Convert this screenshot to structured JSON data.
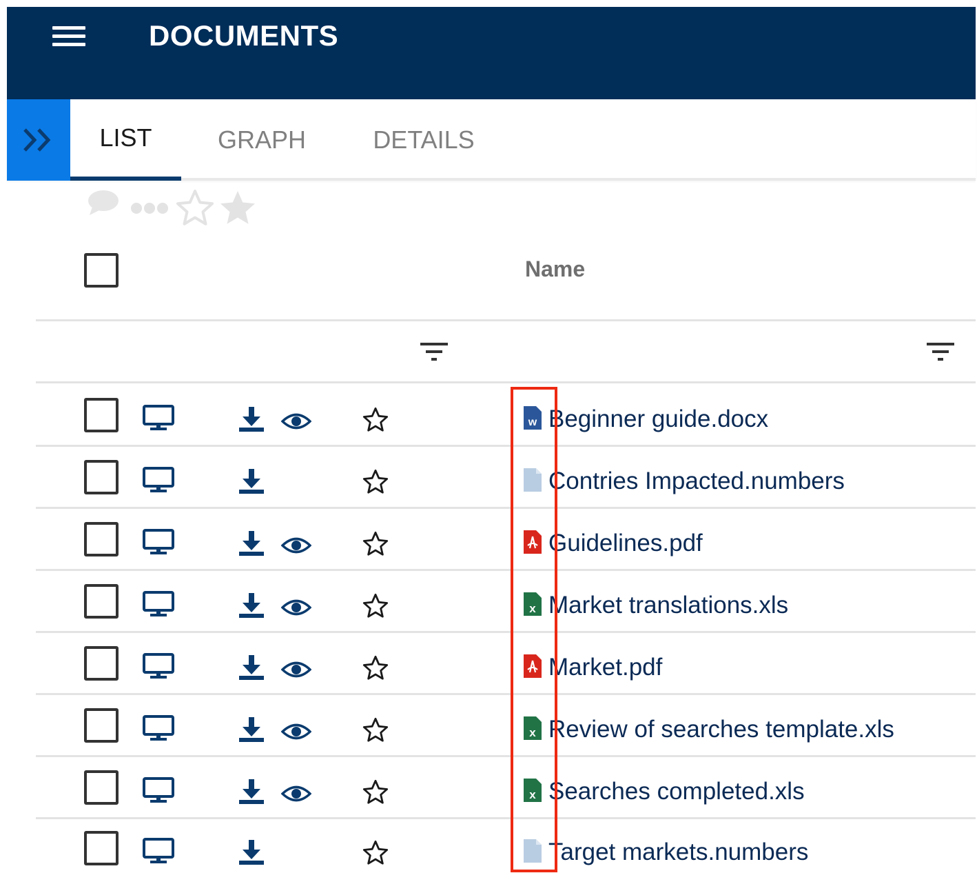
{
  "header": {
    "title": "DOCUMENTS",
    "menu_icon": "hamburger-menu-icon",
    "background": "#012d59"
  },
  "tabs": [
    {
      "label": "LIST",
      "active": true
    },
    {
      "label": "GRAPH",
      "active": false
    },
    {
      "label": "DETAILS",
      "active": false
    }
  ],
  "sidebar_toggle": {
    "icon": "double-chevron-right-icon",
    "color": "#0a7ae6"
  },
  "toolbar": {
    "icons": [
      "comment-icon",
      "more-dots-icon",
      "star-outline-icon",
      "star-filled-icon"
    ]
  },
  "table": {
    "columns": {
      "name": "Name"
    },
    "rows": [
      {
        "name": "Beginner guide.docx",
        "type": "word",
        "preview": true
      },
      {
        "name": "Contries Impacted.numbers",
        "type": "generic",
        "preview": false
      },
      {
        "name": "Guidelines.pdf",
        "type": "pdf",
        "preview": true
      },
      {
        "name": "Market translations.xls",
        "type": "excel",
        "preview": true
      },
      {
        "name": "Market.pdf",
        "type": "pdf",
        "preview": true
      },
      {
        "name": "Review of searches template.xls",
        "type": "excel",
        "preview": true
      },
      {
        "name": "Searches completed.xls",
        "type": "excel",
        "preview": true
      },
      {
        "name": "Target markets.numbers",
        "type": "generic",
        "preview": false
      }
    ]
  },
  "colors": {
    "accent_dark": "#0b2a55",
    "highlight": "#ee2a12",
    "word": "#2b579a",
    "pdf": "#d9261c",
    "excel": "#217346",
    "generic": "#b9cde2"
  }
}
